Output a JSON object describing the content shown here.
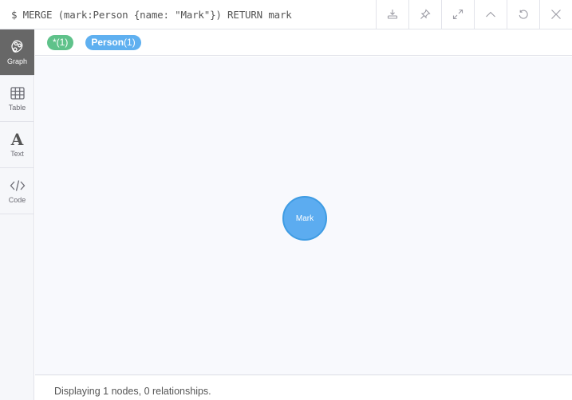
{
  "query": {
    "text": "$ MERGE (mark:Person {name: \"Mark\"}) RETURN mark"
  },
  "actions": [
    {
      "name": "download",
      "icon": "download-icon"
    },
    {
      "name": "pin",
      "icon": "pin-icon"
    },
    {
      "name": "fullscreen",
      "icon": "expand-icon"
    },
    {
      "name": "collapse",
      "icon": "chevron-up-icon"
    },
    {
      "name": "rerun",
      "icon": "refresh-icon"
    },
    {
      "name": "close",
      "icon": "close-icon"
    }
  ],
  "sidebar": {
    "items": [
      {
        "label": "Graph",
        "icon": "graph-icon",
        "active": true
      },
      {
        "label": "Table",
        "icon": "table-icon",
        "active": false
      },
      {
        "label": "Text",
        "icon": "text-icon",
        "active": false
      },
      {
        "label": "Code",
        "icon": "code-icon",
        "active": false
      }
    ]
  },
  "labels": [
    {
      "name": "*",
      "count": "(1)",
      "color": "#5fc28a"
    },
    {
      "name": "Person",
      "count": "(1)",
      "color": "#5fb0f0"
    }
  ],
  "graph": {
    "nodes": [
      {
        "caption": "Mark",
        "label": "Person",
        "color": "#5cacf0",
        "border": "#3f9ce3"
      }
    ]
  },
  "status": {
    "text": "Displaying 1 nodes, 0 relationships."
  }
}
